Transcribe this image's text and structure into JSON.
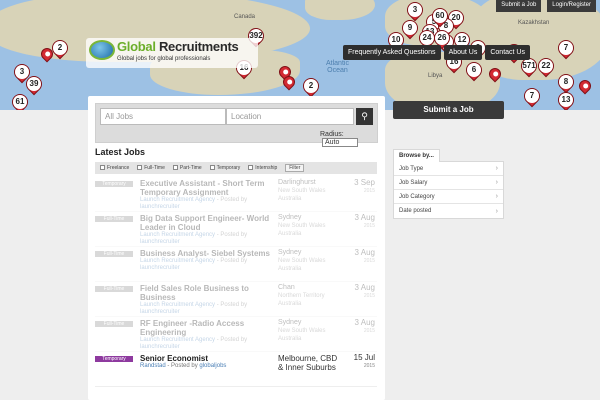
{
  "topbar": {
    "submit_job": "Submit a Job",
    "login": "Login/Register"
  },
  "map": {
    "labels": {
      "canada": "Canada",
      "libya": "Libya",
      "kazakhstan": "Kazakhstan"
    },
    "ocean": {
      "line1": "Atlantic",
      "line2": "Ocean"
    },
    "pins": [
      "2",
      "392",
      "3",
      "39",
      "16",
      "61",
      "2",
      "20",
      "5",
      "3",
      "8",
      "10",
      "9",
      "2",
      "13",
      "24",
      "2",
      "60",
      "26",
      "12",
      "16",
      "6",
      "20",
      "571",
      "7",
      "22",
      "8",
      "7",
      "13"
    ]
  },
  "logo": {
    "title_a": "Global",
    "title_b": " Recruitments",
    "tagline": "Global jobs for global professionals"
  },
  "nav": {
    "faq": "Frequently Asked Questions",
    "about": "About Us",
    "contact": "Contact Us"
  },
  "search": {
    "jobs_placeholder": "All Jobs",
    "location_placeholder": "Location",
    "radius_label": "Radius:",
    "radius_value": "Auto"
  },
  "latest_jobs": {
    "heading": "Latest Jobs",
    "filters": [
      "Freelance",
      "Full-Time",
      "Part-Time",
      "Temporary",
      "Internship"
    ],
    "filter_button": "Filter"
  },
  "jobs": [
    {
      "type": "Temporary",
      "type_color": "#8a8a8a",
      "title": "Executive Assistant - Short Term Temporary Assignment",
      "company": "Launch Recruitment Agency",
      "posted": "- Posted by",
      "poster": "launchrecruiter",
      "location": "Darlinghurst",
      "location_sub": "New South Wales Australia",
      "date": "3 Sep",
      "year": "2015",
      "faded": true
    },
    {
      "type": "Full-Time",
      "type_color": "#8a8a8a",
      "title": "Big Data Support Engineer- World Leader in Cloud",
      "company": "Launch Recruitment Agency",
      "posted": "- Posted by",
      "poster": "launchrecruiter",
      "location": "Sydney",
      "location_sub": "New South Wales Australia",
      "date": "3 Aug",
      "year": "2015",
      "faded": true
    },
    {
      "type": "Full-Time",
      "type_color": "#8a8a8a",
      "title": "Business Analyst- Siebel Systems",
      "company": "Launch Recruitment Agency",
      "posted": "- Posted by",
      "poster": "launchrecruiter",
      "location": "Sydney",
      "location_sub": "New South Wales Australia",
      "date": "3 Aug",
      "year": "2015",
      "faded": true
    },
    {
      "type": "Full-Time",
      "type_color": "#8a8a8a",
      "title": "Field Sales Role Business to Business",
      "company": "Launch Recruitment Agency",
      "posted": "- Posted by",
      "poster": "launchrecruiter",
      "location": "Chan",
      "location_sub": "Northern Territory Australia",
      "date": "3 Aug",
      "year": "2015",
      "faded": true
    },
    {
      "type": "Full-Time",
      "type_color": "#8a8a8a",
      "title": "RF Engineer -Radio Access Engineering",
      "company": "Launch Recruitment Agency",
      "posted": "- Posted by",
      "poster": "launchrecruiter",
      "location": "Sydney",
      "location_sub": "New South Wales Australia",
      "date": "3 Aug",
      "year": "2015",
      "faded": true
    },
    {
      "type": "Temporary",
      "type_color": "#8e3a9f",
      "title": "Senior Economist",
      "company": "Randstad",
      "posted": "- Posted by",
      "poster": "globaljobs",
      "location": "Melbourne, CBD & Inner Suburbs",
      "location_sub": "",
      "date": "15 Jul",
      "year": "2015",
      "faded": false
    }
  ],
  "sidebar": {
    "submit_button": "Submit a Job",
    "browse_tab": "Browse by...",
    "browse_items": [
      "Job Type",
      "Job Salary",
      "Job Category",
      "Date posted"
    ]
  },
  "colors": {
    "pin": "#d32a33",
    "map_water": "#9dc1e4",
    "map_land": "#d8d3b8",
    "logo_green": "#6cae2a",
    "temporary_badge": "#8e3a9f",
    "dark_button": "#3a3a3a"
  }
}
